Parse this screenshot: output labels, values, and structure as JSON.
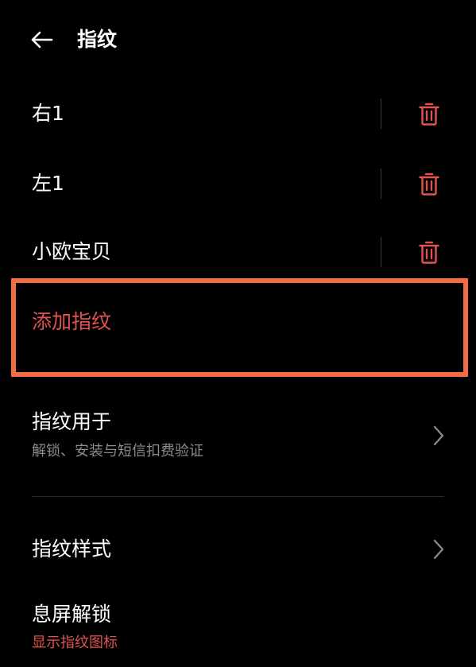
{
  "header": {
    "title": "指纹",
    "back_icon": "arrow-left-icon"
  },
  "fingerprints": [
    {
      "name": "右1"
    },
    {
      "name": "左1"
    },
    {
      "name": "小欧宝贝"
    }
  ],
  "add_fingerprint": {
    "label": "添加指纹"
  },
  "settings": {
    "usage": {
      "title": "指纹用于",
      "subtitle": "解锁、安装与短信扣费验证"
    },
    "style": {
      "title": "指纹样式"
    },
    "screen_off": {
      "title": "息屏解锁",
      "subtitle": "显示指纹图标"
    }
  },
  "colors": {
    "background": "#000000",
    "accent_red": "#e2524f",
    "highlight_border": "#f26d45",
    "secondary_text": "#8c8c8c"
  }
}
